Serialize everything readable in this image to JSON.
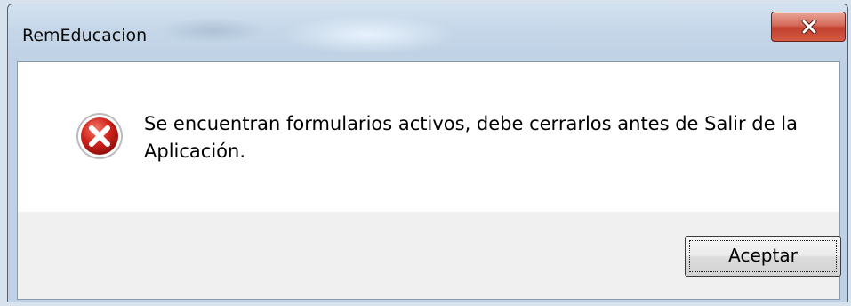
{
  "window": {
    "title": "RemEducacion",
    "close_icon": "close-icon"
  },
  "dialog": {
    "icon": "error-icon",
    "message": "Se encuentran formularios activos, debe cerrarlos antes de Salir de la Aplicación.",
    "ok_label": "Aceptar"
  },
  "colors": {
    "close_button": "#c2402e",
    "error_icon": "#c8102e",
    "button_bar": "#f0f0f0"
  }
}
